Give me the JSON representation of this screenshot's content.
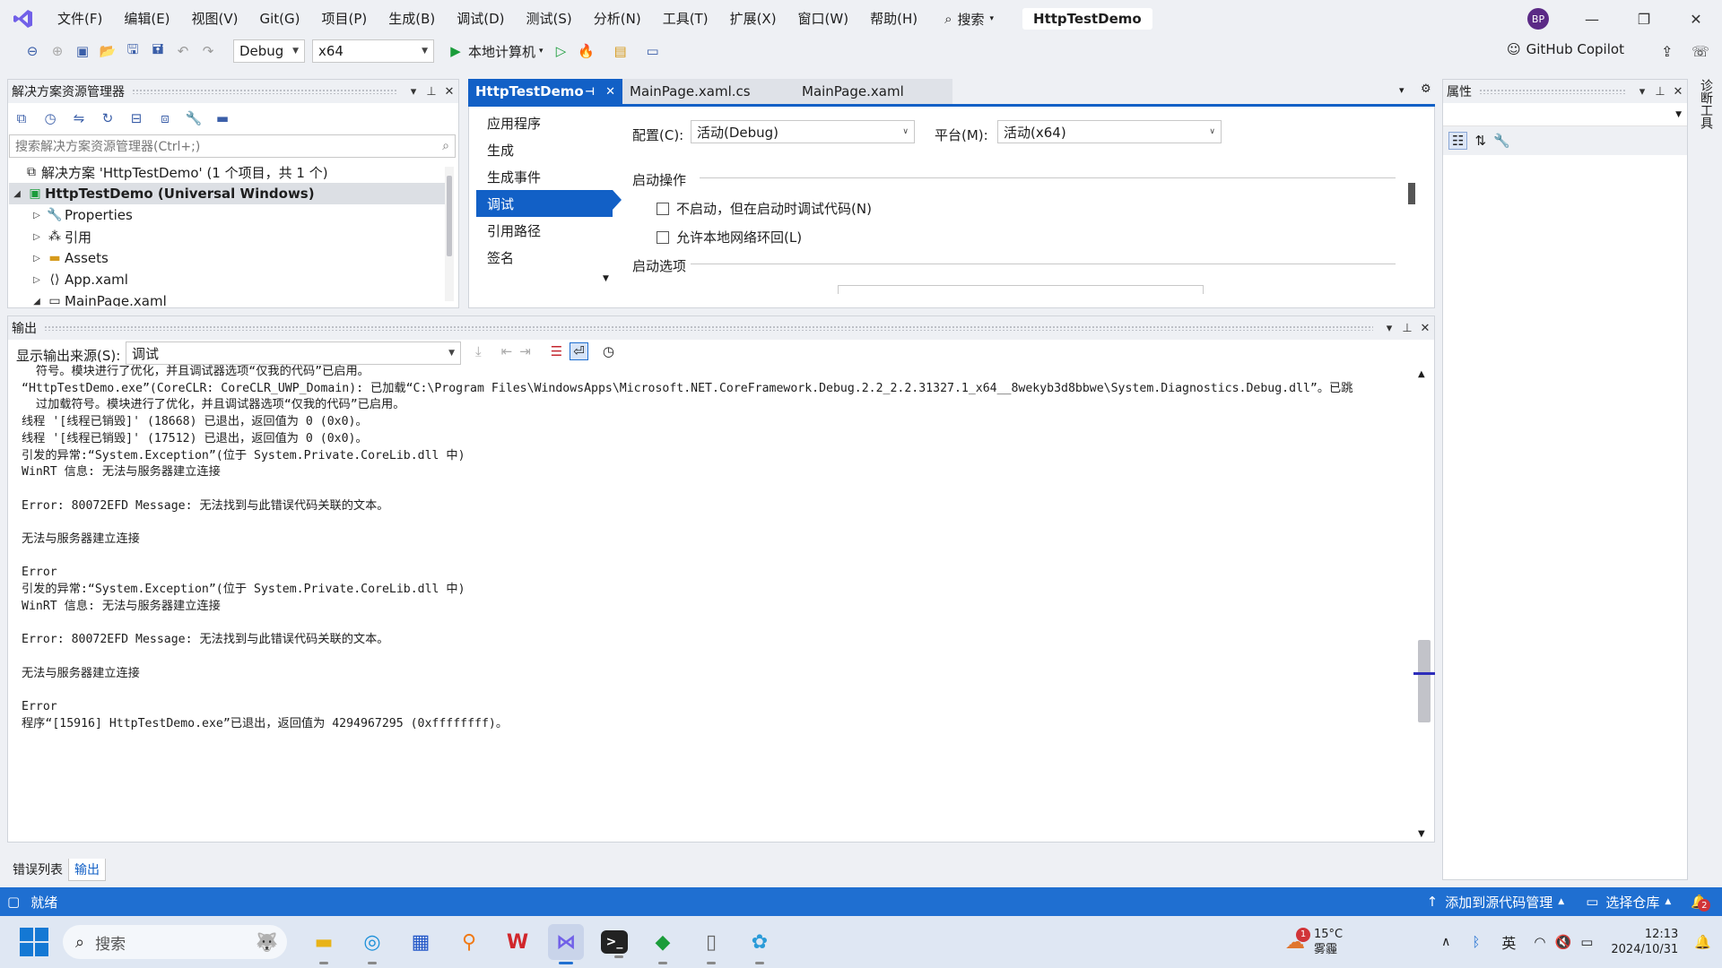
{
  "menu": [
    "文件(F)",
    "编辑(E)",
    "视图(V)",
    "Git(G)",
    "项目(P)",
    "生成(B)",
    "调试(D)",
    "测试(S)",
    "分析(N)",
    "工具(T)",
    "扩展(X)",
    "窗口(W)",
    "帮助(H)"
  ],
  "search": {
    "label": "搜索"
  },
  "title_tab": "HttpTestDemo",
  "avatar_initials": "BP",
  "toolbar": {
    "config": "Debug",
    "platform": "x64",
    "run_target": "本地计算机"
  },
  "copilot_label": "GitHub Copilot",
  "solution_explorer": {
    "title": "解决方案资源管理器",
    "search_placeholder": "搜索解决方案资源管理器(Ctrl+;)",
    "solution": "解决方案 'HttpTestDemo' (1 个项目，共 1 个)",
    "project": "HttpTestDemo (Universal Windows)",
    "items": [
      "Properties",
      "引用",
      "Assets",
      "App.xaml",
      "MainPage.xaml"
    ]
  },
  "doc_tabs": [
    "HttpTestDemo",
    "MainPage.xaml.cs",
    "MainPage.xaml"
  ],
  "property_nav": [
    "应用程序",
    "生成",
    "生成事件",
    "调试",
    "引用路径",
    "签名"
  ],
  "property_nav_selected": "调试",
  "config_label": "配置(C):",
  "config_value": "活动(Debug)",
  "platform_label": "平台(M):",
  "platform_value": "活动(x64)",
  "section_start_action": "启动操作",
  "opt_no_launch": "不启动，但在启动时调试代码(N)",
  "opt_loopback": "允许本地网络环回(L)",
  "section_start_options": "启动选项",
  "properties_title": "属性",
  "side_tab": "诊断工具",
  "output": {
    "title": "输出",
    "source_label": "显示输出来源(S):",
    "source_value": "调试",
    "lines": [
      "  符号。模块进行了优化，并且调试器选项“仅我的代码”已启用。",
      "“HttpTestDemo.exe”(CoreCLR: CoreCLR_UWP_Domain): 已加载“C:\\Program Files\\WindowsApps\\Microsoft.NET.CoreFramework.Debug.2.2_2.2.31327.1_x64__8wekyb3d8bbwe\\System.Diagnostics.Debug.dll”。已跳",
      "  过加载符号。模块进行了优化，并且调试器选项“仅我的代码”已启用。",
      "线程 '[线程已销毁]' (18668) 已退出，返回值为 0 (0x0)。",
      "线程 '[线程已销毁]' (17512) 已退出，返回值为 0 (0x0)。",
      "引发的异常:“System.Exception”(位于 System.Private.CoreLib.dll 中)",
      "WinRT 信息: 无法与服务器建立连接",
      "",
      "Error: 80072EFD Message: 无法找到与此错误代码关联的文本。",
      "",
      "无法与服务器建立连接",
      "",
      "Error",
      "引发的异常:“System.Exception”(位于 System.Private.CoreLib.dll 中)",
      "WinRT 信息: 无法与服务器建立连接",
      "",
      "Error: 80072EFD Message: 无法找到与此错误代码关联的文本。",
      "",
      "无法与服务器建立连接",
      "",
      "Error",
      "程序“[15916] HttpTestDemo.exe”已退出，返回值为 4294967295 (0xffffffff)。"
    ]
  },
  "bottom_tabs": [
    "错误列表",
    "输出"
  ],
  "status": {
    "ready": "就绪",
    "add_source": "添加到源代码管理",
    "select_repo": "选择仓库"
  },
  "taskbar": {
    "search_placeholder": "搜索",
    "weather_temp": "15°C",
    "weather_desc": "雾霾",
    "weather_badge": "1",
    "ime": "英",
    "time": "12:13",
    "date": "2024/10/31",
    "notif_count": "2"
  },
  "colors": {
    "accent": "#1f6fd1",
    "selected_nav": "#1260c6",
    "vs_purple": "#7160e8"
  }
}
